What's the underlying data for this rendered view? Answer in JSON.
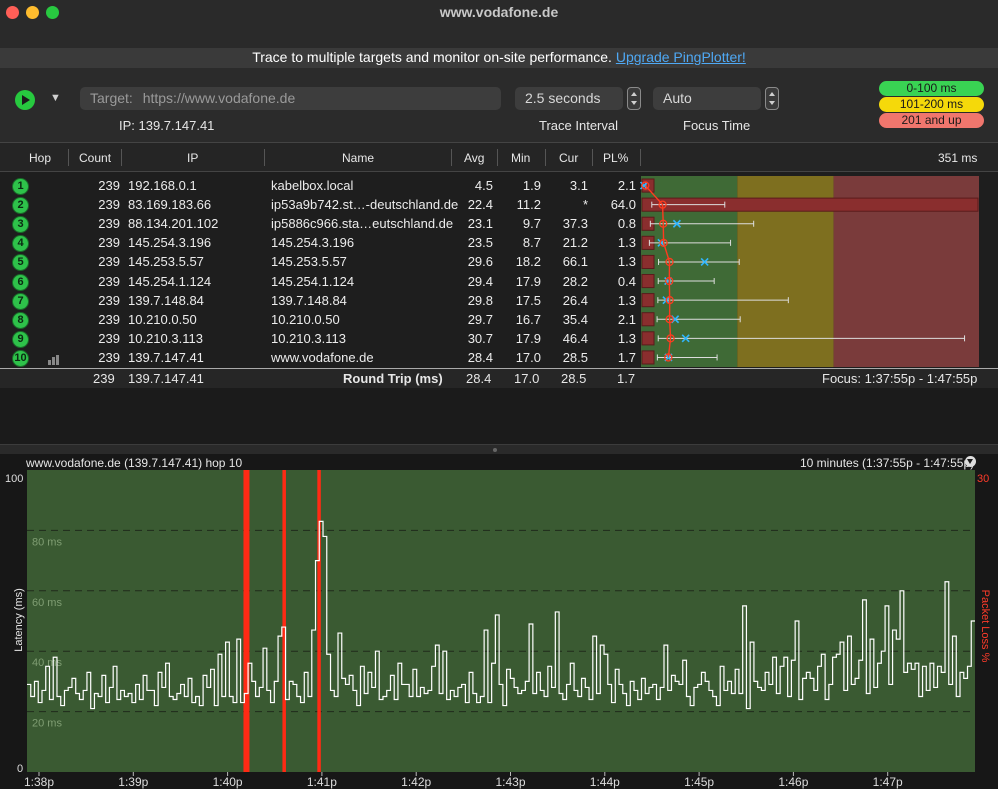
{
  "window": {
    "title": "www.vodafone.de"
  },
  "promo": {
    "text": "Trace to multiple targets and monitor on-site performance.",
    "link": "Upgrade PingPlotter!"
  },
  "controls": {
    "target_label": "Target:",
    "target_placeholder": "https://www.vodafone.de",
    "interval_value": "2.5 seconds",
    "interval_label": "Trace Interval",
    "focus_value": "Auto",
    "focus_label": "Focus Time",
    "ip_text": "IP:  139.7.147.41"
  },
  "legend": [
    {
      "label": "0-100 ms",
      "color": "#39d353"
    },
    {
      "label": "101-200 ms",
      "color": "#f5d90a"
    },
    {
      "label": "201 and up",
      "color": "#f0766d"
    }
  ],
  "table": {
    "headers": {
      "hop": "Hop",
      "count": "Count",
      "ip": "IP",
      "name": "Name",
      "avg": "Avg",
      "min": "Min",
      "cur": "Cur",
      "pl": "PL%",
      "scale": "351 ms"
    },
    "rows": [
      {
        "hop": "1",
        "count": "239",
        "ip": "192.168.0.1",
        "name": "kabelbox.local",
        "avg": "4.5",
        "min": "1.9",
        "cur": "3.1",
        "pl": "2.1",
        "avg_ms": 4.5,
        "min_ms": 1.9,
        "max_ms": 5,
        "cur_ms": 3.1,
        "loss": 2.1
      },
      {
        "hop": "2",
        "count": "239",
        "ip": "83.169.183.66",
        "name": "ip53a9b742.st…-deutschland.de",
        "avg": "22.4",
        "min": "11.2",
        "cur": "*",
        "pl": "64.0",
        "avg_ms": 22.4,
        "min_ms": 11.2,
        "max_ms": 87,
        "cur_ms": null,
        "loss": 64.0
      },
      {
        "hop": "3",
        "count": "239",
        "ip": "88.134.201.102",
        "name": "ip5886c966.sta…eutschland.de",
        "avg": "23.1",
        "min": "9.7",
        "cur": "37.3",
        "pl": "0.8",
        "avg_ms": 23.1,
        "min_ms": 9.7,
        "max_ms": 117,
        "cur_ms": 37.3,
        "loss": 0.8
      },
      {
        "hop": "4",
        "count": "239",
        "ip": "145.254.3.196",
        "name": "145.254.3.196",
        "avg": "23.5",
        "min": "8.7",
        "cur": "21.2",
        "pl": "1.3",
        "avg_ms": 23.5,
        "min_ms": 8.7,
        "max_ms": 93,
        "cur_ms": 21.2,
        "loss": 1.3
      },
      {
        "hop": "5",
        "count": "239",
        "ip": "145.253.5.57",
        "name": "145.253.5.57",
        "avg": "29.6",
        "min": "18.2",
        "cur": "66.1",
        "pl": "1.3",
        "avg_ms": 29.6,
        "min_ms": 18.2,
        "max_ms": 102,
        "cur_ms": 66.1,
        "loss": 1.3
      },
      {
        "hop": "6",
        "count": "239",
        "ip": "145.254.1.124",
        "name": "145.254.1.124",
        "avg": "29.4",
        "min": "17.9",
        "cur": "28.2",
        "pl": "0.4",
        "avg_ms": 29.4,
        "min_ms": 17.9,
        "max_ms": 76,
        "cur_ms": 28.2,
        "loss": 0.4
      },
      {
        "hop": "7",
        "count": "239",
        "ip": "139.7.148.84",
        "name": "139.7.148.84",
        "avg": "29.8",
        "min": "17.5",
        "cur": "26.4",
        "pl": "1.3",
        "avg_ms": 29.8,
        "min_ms": 17.5,
        "max_ms": 153,
        "cur_ms": 26.4,
        "loss": 1.3
      },
      {
        "hop": "8",
        "count": "239",
        "ip": "10.210.0.50",
        "name": "10.210.0.50",
        "avg": "29.7",
        "min": "16.7",
        "cur": "35.4",
        "pl": "2.1",
        "avg_ms": 29.7,
        "min_ms": 16.7,
        "max_ms": 103,
        "cur_ms": 35.4,
        "loss": 2.1
      },
      {
        "hop": "9",
        "count": "239",
        "ip": "10.210.3.113",
        "name": "10.210.3.113",
        "avg": "30.7",
        "min": "17.9",
        "cur": "46.4",
        "pl": "1.3",
        "avg_ms": 30.7,
        "min_ms": 17.9,
        "max_ms": 336,
        "cur_ms": 46.4,
        "loss": 1.3
      },
      {
        "hop": "10",
        "count": "239",
        "ip": "139.7.147.41",
        "name": "www.vodafone.de",
        "avg": "28.4",
        "min": "17.0",
        "cur": "28.5",
        "pl": "1.7",
        "avg_ms": 28.4,
        "min_ms": 17.0,
        "max_ms": 79,
        "cur_ms": 28.5,
        "loss": 1.7
      }
    ],
    "roundtrip": {
      "count": "239",
      "ip": "139.7.147.41",
      "label": "Round Trip (ms)",
      "avg": "28.4",
      "min": "17.0",
      "cur": "28.5",
      "pl": "1.7",
      "focus": "Focus: 1:37:55p - 1:47:55p"
    }
  },
  "graph": {
    "header_left": "www.vodafone.de (139.7.147.41) hop 10",
    "header_right": "10 minutes (1:37:55p - 1:47:55p)",
    "ylabel": "Latency (ms)",
    "y2label": "Packet Loss %",
    "y_top": "100",
    "y_bottom": "0",
    "y2_top": "30",
    "y_grid_labels": [
      "80 ms",
      "60 ms",
      "40 ms",
      "20 ms"
    ],
    "x_labels": [
      "1:38p",
      "1:39p",
      "1:40p",
      "1:41p",
      "1:42p",
      "1:43p",
      "1:44p",
      "1:45p",
      "1:46p",
      "1:47p"
    ]
  },
  "chart_data": {
    "type": "line",
    "title": "www.vodafone.de (139.7.147.41) hop 10",
    "xlabel": "",
    "ylabel": "Latency (ms)",
    "y2label": "Packet Loss %",
    "ylim": [
      0,
      100
    ],
    "y2lim": [
      0,
      30
    ],
    "x_ticks": [
      "1:38p",
      "1:39p",
      "1:40p",
      "1:41p",
      "1:42p",
      "1:43p",
      "1:44p",
      "1:45p",
      "1:46p",
      "1:47p"
    ],
    "latency_ms": [
      29,
      25,
      30,
      23,
      27,
      35,
      24,
      38,
      25,
      22,
      27,
      28,
      31,
      26,
      24,
      27,
      33,
      21,
      26,
      25,
      32,
      23,
      28,
      35,
      24,
      27,
      25,
      26,
      23,
      29,
      24,
      32,
      27,
      27,
      22,
      33,
      28,
      36,
      25,
      24,
      26,
      29,
      25,
      31,
      23,
      25,
      22,
      32,
      28,
      34,
      22,
      39,
      25,
      43,
      25,
      23,
      44,
      23,
      26,
      36,
      30,
      25,
      28,
      41,
      27,
      23,
      30,
      45,
      48,
      24,
      30,
      29,
      25,
      23,
      33,
      25,
      47,
      70,
      83,
      78,
      39,
      27,
      25,
      46,
      31,
      29,
      32,
      27,
      22,
      35,
      26,
      33,
      28,
      40,
      24,
      25,
      27,
      32,
      24,
      36,
      29,
      29,
      25,
      34,
      25,
      28,
      26,
      27,
      35,
      42,
      26,
      40,
      24,
      27,
      25,
      28,
      29,
      23,
      33,
      26,
      23,
      25,
      47,
      23,
      36,
      52,
      29,
      22,
      34,
      31,
      28,
      26,
      27,
      30,
      49,
      26,
      33,
      27,
      25,
      35,
      28,
      53,
      26,
      24,
      29,
      36,
      27,
      25,
      31,
      28,
      24,
      45,
      26,
      42,
      39,
      29,
      23,
      34,
      29,
      26,
      22,
      30,
      27,
      24,
      31,
      26,
      28,
      29,
      24,
      28,
      42,
      27,
      32,
      30,
      29,
      37,
      25,
      22,
      28,
      29,
      33,
      30,
      27,
      25,
      22,
      35,
      27,
      30,
      26,
      34,
      26,
      55,
      21,
      43,
      30,
      28,
      27,
      33,
      29,
      38,
      26,
      35,
      38,
      25,
      37,
      50,
      24,
      31,
      33,
      31,
      27,
      35,
      39,
      24,
      29,
      38,
      39,
      43,
      27,
      45,
      29,
      31,
      37,
      57,
      26,
      44,
      28,
      36,
      40,
      55,
      29,
      47,
      44,
      60,
      33,
      36,
      34,
      36,
      25,
      35,
      27,
      36,
      28,
      35,
      33,
      63,
      29,
      45,
      25,
      33,
      31,
      35,
      50
    ],
    "packet_loss_events": [
      {
        "time": "1:40:15p",
        "width": "wide"
      },
      {
        "time": "1:40:40p",
        "width": "narrow"
      },
      {
        "time": "1:41:05p",
        "width": "narrow"
      }
    ]
  }
}
